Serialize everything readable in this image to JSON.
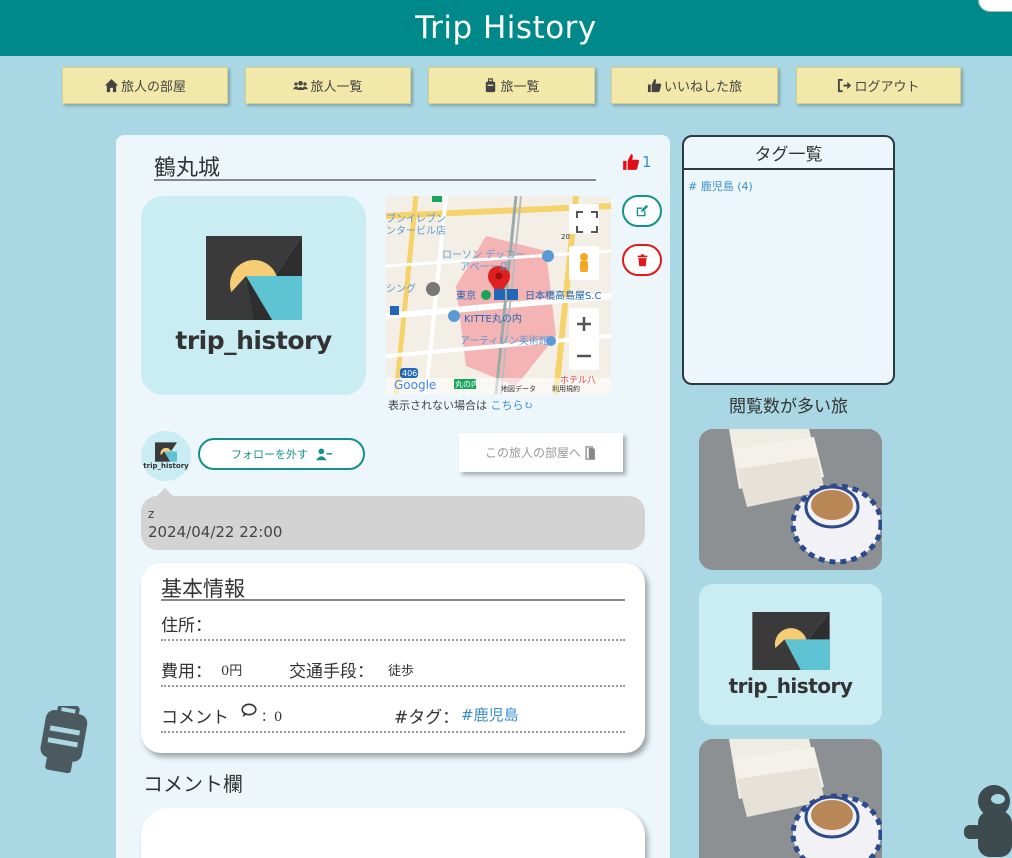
{
  "header": {
    "title": "Trip History"
  },
  "nav": [
    {
      "label": "旅人の部屋",
      "icon": "home-icon"
    },
    {
      "label": "旅人一覧",
      "icon": "users-icon"
    },
    {
      "label": "旅一覧",
      "icon": "suitcase-icon"
    },
    {
      "label": "いいねした旅",
      "icon": "thumbs-up-icon"
    },
    {
      "label": "ログアウト",
      "icon": "sign-out-icon"
    }
  ],
  "trip": {
    "title": "鶴丸城",
    "like_count": "1",
    "logo_text": "trip_history",
    "map_note": "表示されない場合は",
    "map_link": "こちら",
    "map_labels": {
      "station": "東京",
      "seven": "ブンイレブン",
      "seven2": "ンタービル店",
      "lawson": "ローソン デッコー",
      "lawson2": "アベー一店",
      "nihonbashi": "日本橋高島屋S.C",
      "kitte": "KITTE丸の内",
      "artizon": "アーティゾン美術館",
      "hotel": "ホテル八",
      "ring": "シング",
      "marunouchi": "丸の内",
      "route": "406",
      "map_data": "地図データ",
      "terms": "利用規約",
      "google": "Google",
      "num20": "20"
    }
  },
  "user": {
    "avatar_text": "trip_history",
    "unfollow_label": "フォローを外す",
    "room_label": "この旅人の部屋へ"
  },
  "post": {
    "user": "z",
    "date": "2024/04/22 22:00"
  },
  "info": {
    "heading": "基本情報",
    "address_label": "住所：",
    "address_value": "",
    "cost_label": "費用：",
    "cost_value": "0円",
    "transport_label": "交通手段：",
    "transport_value": "徒歩",
    "comment_label": "コメント",
    "comment_value": "：0",
    "tag_label": "#タグ：",
    "tag_value": "#鹿児島"
  },
  "comments": {
    "heading": "コメント欄"
  },
  "sidebar": {
    "tags_title": "タグ一覧",
    "tags": [
      "# 鹿児島 (4)"
    ],
    "popular_title": "閲覧数が多い旅",
    "popular_logo_text": "trip_history"
  },
  "colors": {
    "header": "#00898a",
    "background": "#a9d8e4",
    "nav_button": "#f1e8a9",
    "accent_teal": "#13908b",
    "danger": "#e01818",
    "link": "#3a8fc8"
  }
}
